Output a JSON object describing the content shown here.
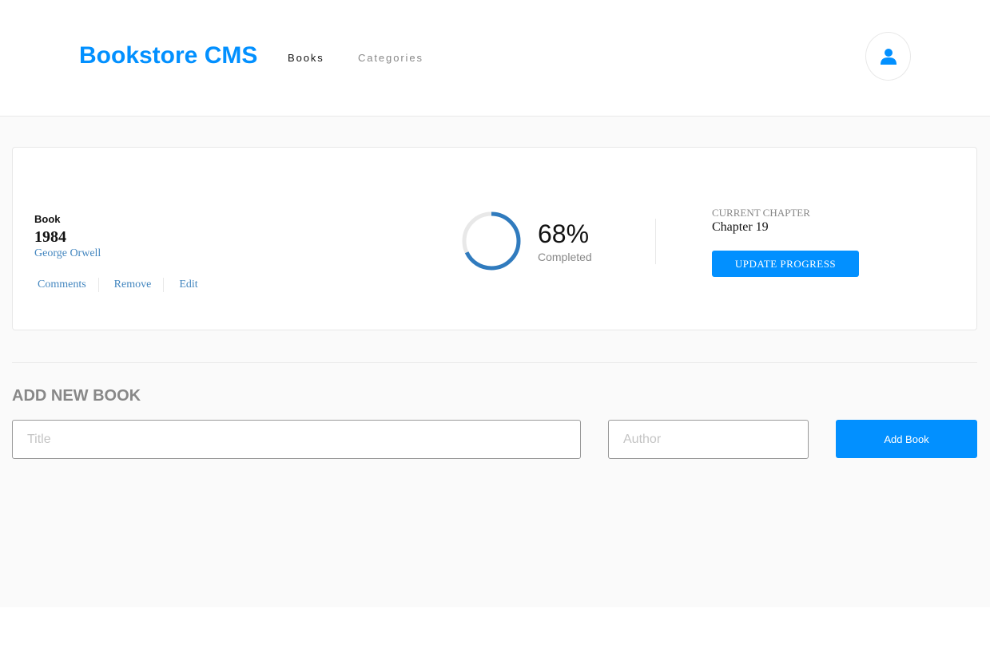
{
  "header": {
    "brand": "Bookstore CMS",
    "nav": [
      {
        "label": "Books"
      },
      {
        "label": "Categories"
      }
    ],
    "user_icon": "user-icon"
  },
  "book": {
    "genre": "Book",
    "title": "1984",
    "author": "George Orwell",
    "actions": [
      {
        "label": "Comments"
      },
      {
        "label": "Remove"
      },
      {
        "label": "Edit"
      }
    ],
    "progress_value": 0.68,
    "progress_percent": "68%",
    "progress_label": "Completed",
    "chapter_label": "CURRENT CHAPTER",
    "chapter_value": "Chapter 19",
    "update_label": "UPDATE PROGRESS"
  },
  "form": {
    "title": "ADD NEW BOOK",
    "title_placeholder": "Title",
    "author_placeholder": "Author",
    "submit_label": "Add Book"
  },
  "colors": {
    "accent": "#0290ff",
    "progress": "#307bbe",
    "track": "#e8e8e8",
    "link": "#4386bf"
  }
}
